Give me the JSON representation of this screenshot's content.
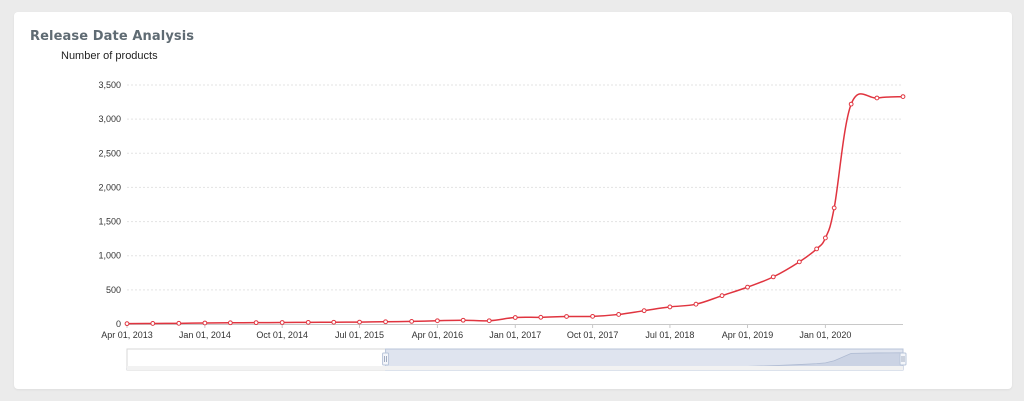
{
  "card": {
    "title": "Release Date Analysis"
  },
  "colors": {
    "line": "#e0343f",
    "grid": "#e3e3e3",
    "navigator_fill": "#dfe4ef",
    "navigator_handle": "#b9c5da"
  },
  "chart_data": {
    "type": "line",
    "title": "Release Date Analysis",
    "ylabel": "Number of products",
    "xlabel": "",
    "ylim": [
      0,
      3500
    ],
    "yticks": [
      0,
      500,
      1000,
      1500,
      2000,
      2500,
      3000,
      3500
    ],
    "ytick_labels": [
      "0",
      "500",
      "1,000",
      "1,500",
      "2,000",
      "2,500",
      "3,000",
      "3,500"
    ],
    "xlim": [
      "2013-04-01",
      "2020-10-01"
    ],
    "xticks": [
      "2013-04-01",
      "2014-01-01",
      "2014-10-01",
      "2015-07-01",
      "2016-04-01",
      "2017-01-01",
      "2017-10-01",
      "2018-07-01",
      "2019-04-01",
      "2020-01-01"
    ],
    "xtick_labels": [
      "Apr 01, 2013",
      "Jan 01, 2014",
      "Oct 01, 2014",
      "Jul 01, 2015",
      "Apr 01, 2016",
      "Jan 01, 2017",
      "Oct 01, 2017",
      "Jul 01, 2018",
      "Apr 01, 2019",
      "Jan 01, 2020"
    ],
    "grid": true,
    "legend": "none",
    "navigator": {
      "range": [
        "2015-10-01",
        "2020-10-01"
      ]
    },
    "series": [
      {
        "x": [
          "2013-04-01",
          "2013-07-01",
          "2013-10-01",
          "2014-01-01",
          "2014-04-01",
          "2014-07-01",
          "2014-10-01",
          "2015-01-01",
          "2015-04-01",
          "2015-07-01",
          "2015-10-01",
          "2016-01-01",
          "2016-04-01",
          "2016-07-01",
          "2016-10-01",
          "2017-01-01",
          "2017-04-01",
          "2017-07-01",
          "2017-10-01",
          "2018-01-01",
          "2018-04-01",
          "2018-07-01",
          "2018-10-01",
          "2019-01-01",
          "2019-04-01",
          "2019-07-01",
          "2019-10-01",
          "2019-12-01",
          "2020-01-01",
          "2020-02-01",
          "2020-04-01",
          "2020-07-01",
          "2020-10-01"
        ],
        "y": [
          5,
          8,
          10,
          15,
          18,
          20,
          22,
          24,
          26,
          28,
          33,
          38,
          48,
          55,
          48,
          95,
          98,
          110,
          112,
          140,
          195,
          250,
          290,
          415,
          540,
          690,
          910,
          1100,
          1260,
          1700,
          3220,
          3310,
          3330
        ]
      }
    ]
  }
}
